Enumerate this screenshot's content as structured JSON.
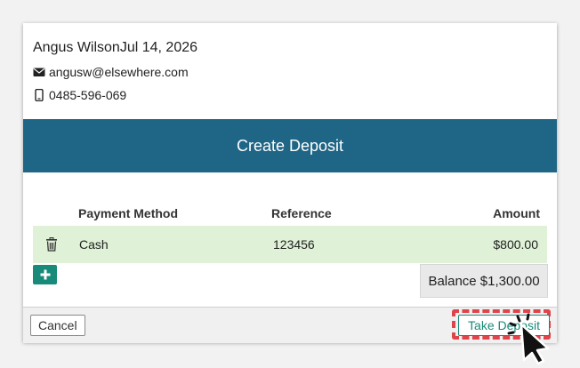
{
  "customer": {
    "name": "Angus Wilson",
    "date": "Jul 14, 2026",
    "email": "angusw@elsewhere.com",
    "phone": "0485-596-069"
  },
  "header": {
    "title": "Create Deposit"
  },
  "table": {
    "columns": {
      "method": "Payment Method",
      "reference": "Reference",
      "amount": "Amount"
    },
    "rows": [
      {
        "method": "Cash",
        "reference": "123456",
        "amount": "$800.00"
      }
    ]
  },
  "balance": {
    "text": "Balance $1,300.00"
  },
  "footer": {
    "cancel_label": "Cancel",
    "deposit_label": "Take Deposit"
  },
  "colors": {
    "header": "#1e6586",
    "accent": "#178a7a",
    "row": "#dff1d6",
    "highlight": "#e0434a"
  },
  "icons": [
    "envelope-icon",
    "phone-icon",
    "trash-icon",
    "plus-icon",
    "cursor-icon"
  ]
}
